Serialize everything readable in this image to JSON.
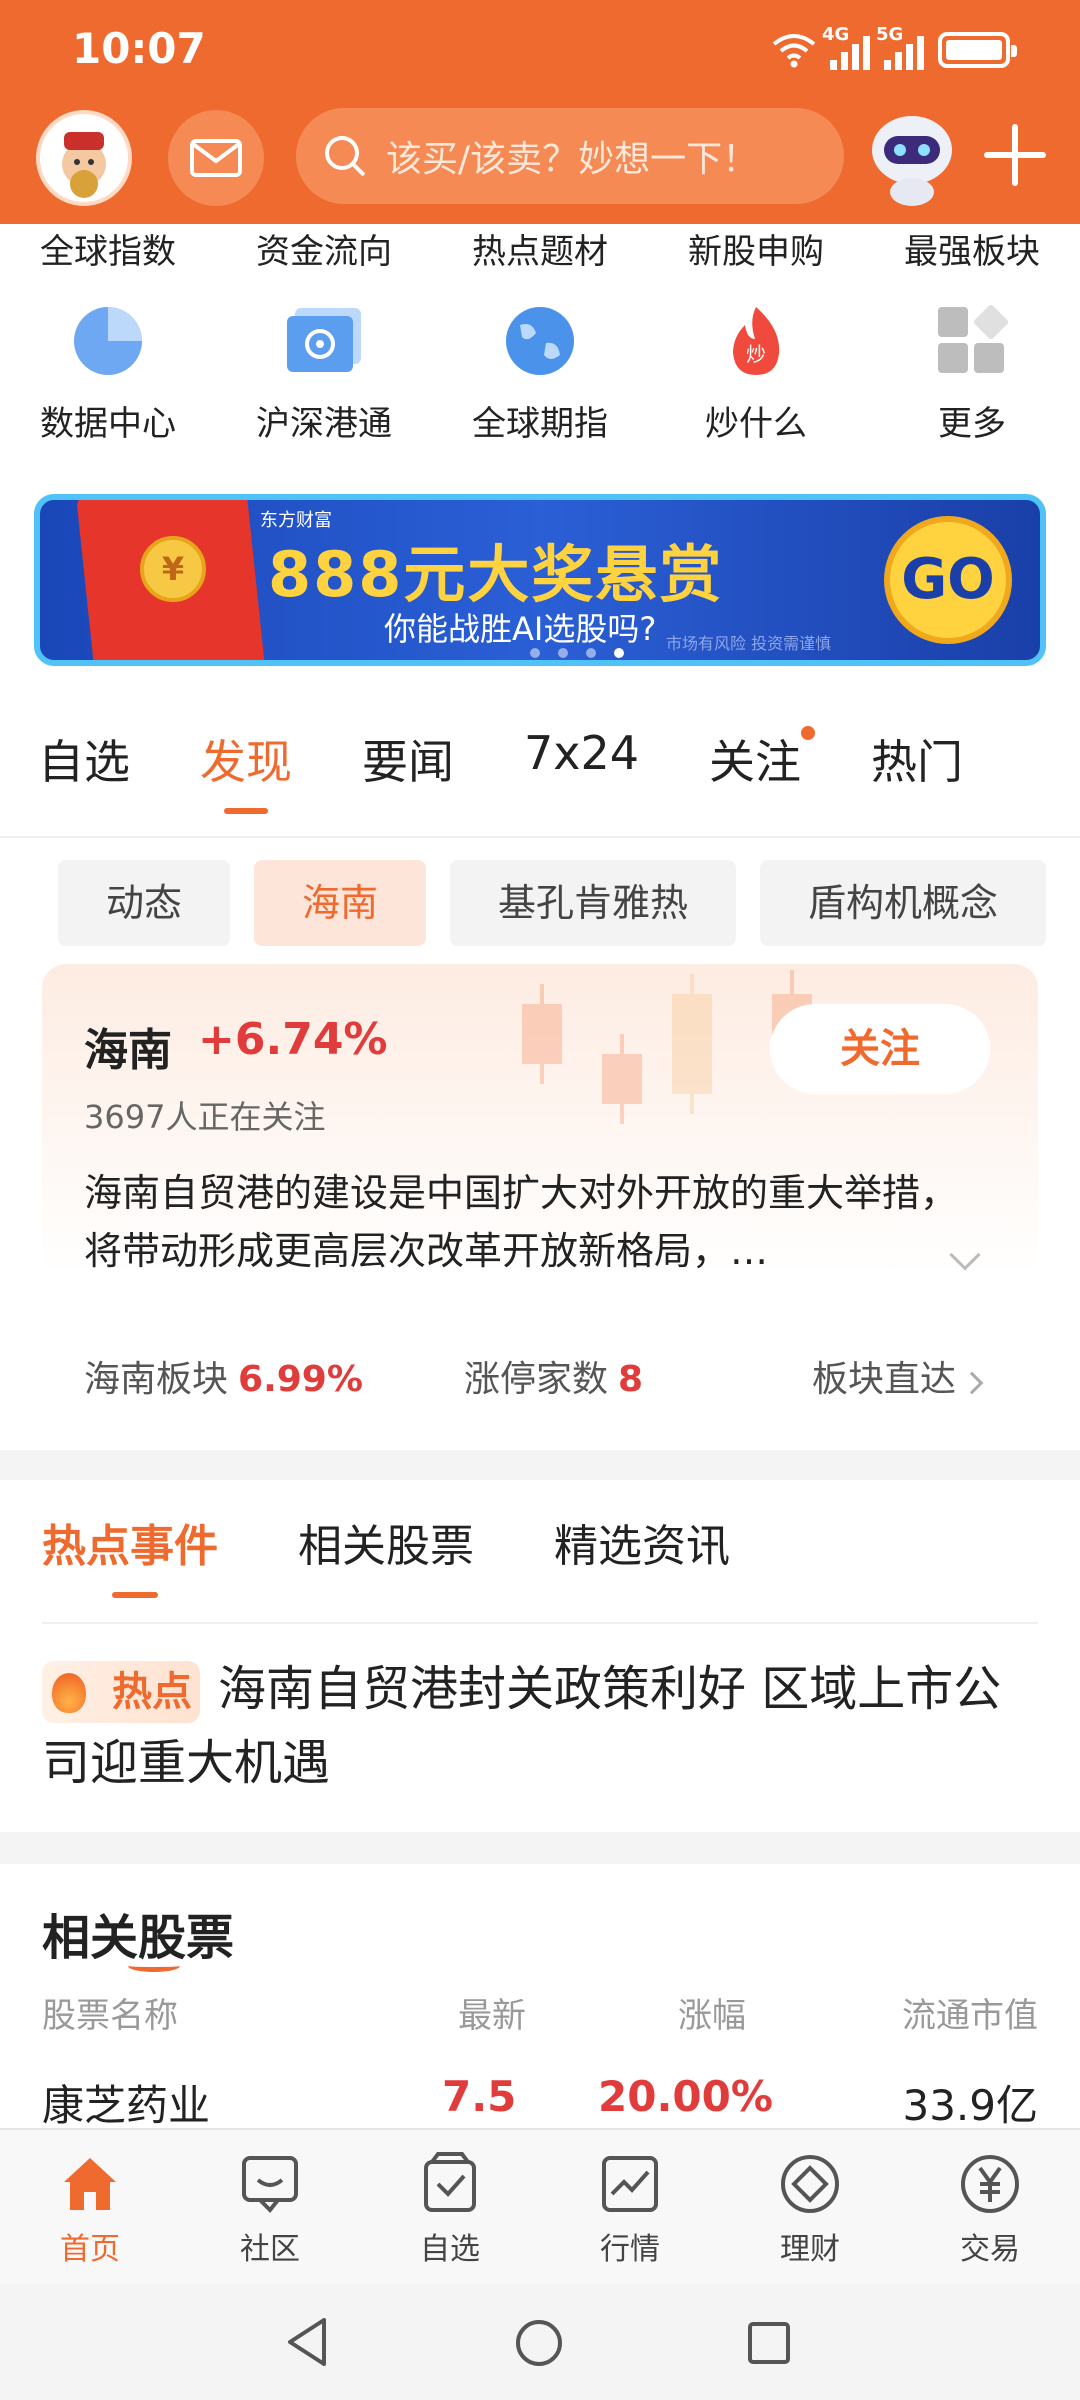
{
  "status": {
    "time": "10:07",
    "net1": "4G",
    "net2": "5G"
  },
  "header": {
    "search_placeholder": "该买/该卖？妙想一下！"
  },
  "quick_row_top": [
    "全球指数",
    "资金流向",
    "热点题材",
    "新股申购",
    "最强板块"
  ],
  "quick_row_icons": [
    {
      "label": "数据中心",
      "icon": "pie-chart-icon"
    },
    {
      "label": "沪深港通",
      "icon": "hk-flower-icon"
    },
    {
      "label": "全球期指",
      "icon": "globe-icon"
    },
    {
      "label": "炒什么",
      "icon": "flame-icon"
    },
    {
      "label": "更多",
      "icon": "grid-more-icon"
    }
  ],
  "banner": {
    "brand": "东方财富",
    "headline": "888元大奖悬赏",
    "subline": "你能战胜AI选股吗?",
    "go": "GO",
    "coin": "¥",
    "risk": "市场有风险 投资需谨慎"
  },
  "main_tabs": [
    "自选",
    "发现",
    "要闻",
    "7x24",
    "关注",
    "热门"
  ],
  "chips": [
    "动态",
    "海南",
    "基孔肯雅热",
    "盾构机概念"
  ],
  "card": {
    "name": "海南",
    "change": "+6.74%",
    "followers": "3697人正在关注",
    "follow_btn": "关注",
    "desc": "海南自贸港的建设是中国扩大对外开放的重大举措，将带动形成更高层次改革开放新格局，…"
  },
  "stats": {
    "sector_label": "海南板块",
    "sector_value": "6.99%",
    "limitup_label": "涨停家数",
    "limitup_value": "8",
    "goto_label": "板块直达"
  },
  "sub_tabs": [
    "热点事件",
    "相关股票",
    "精选资讯"
  ],
  "hot": {
    "tag": "热点",
    "text": "海南自贸港封关政策利好 区域上市公司迎重大机遇"
  },
  "stocks": {
    "title": "相关股票",
    "headers": [
      "股票名称",
      "最新",
      "涨幅",
      "流通市值"
    ],
    "rows": [
      {
        "name": "康芝药业",
        "price": "7.5",
        "change": "20.00%",
        "cap": "33.9亿"
      }
    ]
  },
  "bottom_nav": [
    "首页",
    "社区",
    "自选",
    "行情",
    "理财",
    "交易"
  ],
  "colors": {
    "brand": "#ef6a2e",
    "up": "#e13c3c"
  }
}
